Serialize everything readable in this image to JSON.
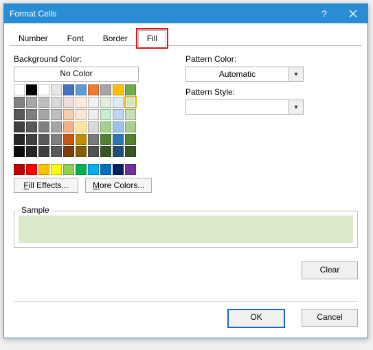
{
  "title": "Format Cells",
  "tabs": {
    "number": "Number",
    "font": "Font",
    "border": "Border",
    "fill": "Fill"
  },
  "left": {
    "bg_label": "Background Color:",
    "no_color": "No Color",
    "fill_effects": "ill Effects...",
    "fill_effects_u": "F",
    "more_colors": "ore Colors...",
    "more_colors_u": "M"
  },
  "right": {
    "pattern_color_label": "Pattern Color:",
    "pattern_color_value": "Automatic",
    "pattern_style_label": "Pattern Style:",
    "pattern_style_value": ""
  },
  "sample_label": "Sample",
  "clear": "Clear",
  "ok": "OK",
  "cancel": "Cancel",
  "swatches": {
    "main": [
      [
        "",
        "#000000",
        "#ffffff",
        "#e7e6e6",
        "#4472c4",
        "#5b9bd5",
        "#ed7d31",
        "#a5a5a5",
        "#ffc000",
        "#70ad47"
      ],
      [
        "#808080",
        "#a6a6a6",
        "#bfbfbf",
        "#d9d9d9",
        "#f2dcdb",
        "#fdeada",
        "#f2f2f2",
        "#e2efda",
        "#deebf6",
        "#d0e7be"
      ],
      [
        "#595959",
        "#808080",
        "#a6a6a6",
        "#bfbfbf",
        "#f8cbad",
        "#fce4d6",
        "#ededed",
        "#c6efce",
        "#bdd7ee",
        "#c5e0b4"
      ],
      [
        "#404040",
        "#595959",
        "#808080",
        "#a6a6a6",
        "#f4b084",
        "#ffe699",
        "#d9d9d9",
        "#a9d08e",
        "#9bc2e6",
        "#a9d08e"
      ],
      [
        "#262626",
        "#404040",
        "#595959",
        "#808080",
        "#c65911",
        "#bf8f00",
        "#7b7b7b",
        "#548235",
        "#2f75b5",
        "#548235"
      ],
      [
        "#0d0d0d",
        "#262626",
        "#404040",
        "#595959",
        "#833c0c",
        "#806000",
        "#525252",
        "#375623",
        "#1f4e78",
        "#375623"
      ]
    ],
    "standard": [
      "#c00000",
      "#ff0000",
      "#ffc000",
      "#ffff00",
      "#92d050",
      "#00b050",
      "#00b0f0",
      "#0070c0",
      "#002060",
      "#7030a0"
    ],
    "selected_row": 1,
    "selected_col": 9
  }
}
